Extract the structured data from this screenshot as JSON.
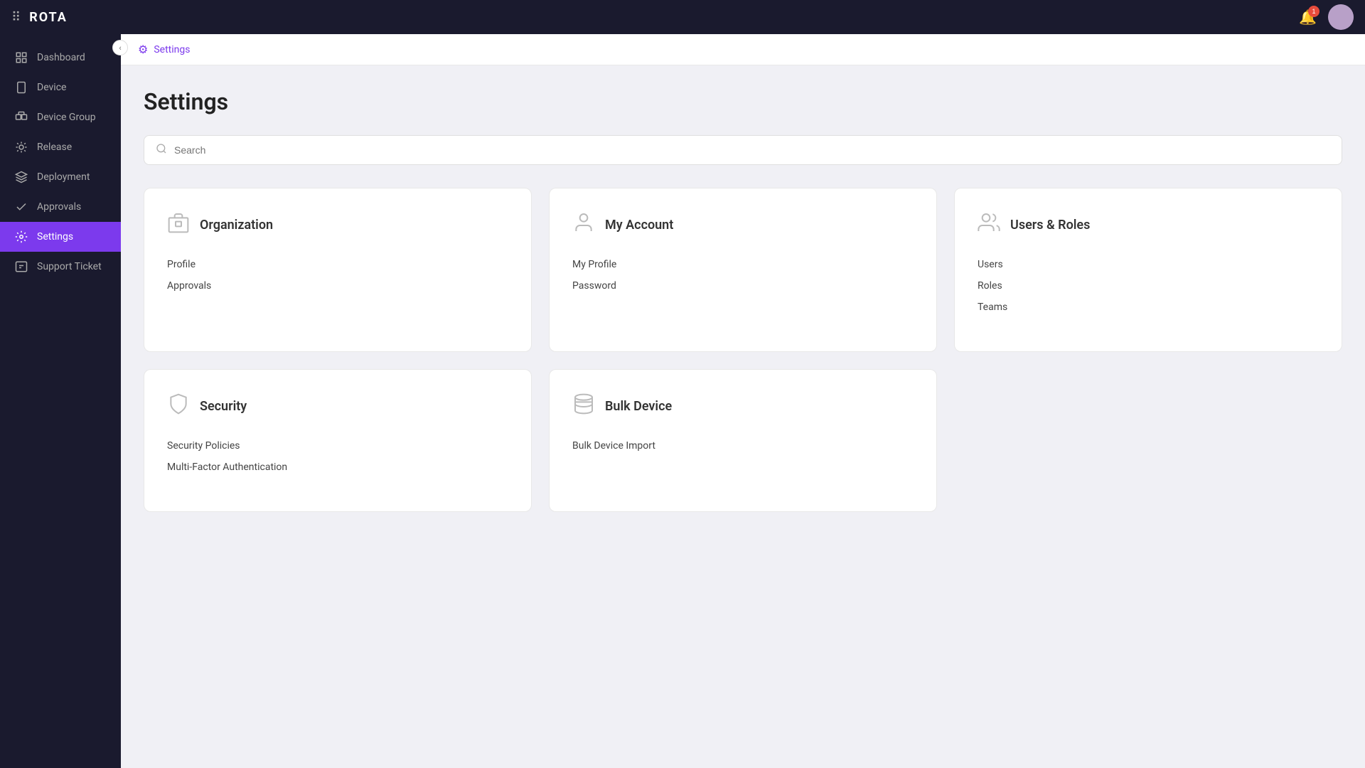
{
  "app": {
    "name": "ROTA"
  },
  "topbar": {
    "notification_count": "1",
    "notification_icon": "🔔"
  },
  "sidebar": {
    "collapse_icon": "‹",
    "items": [
      {
        "id": "dashboard",
        "label": "Dashboard",
        "icon": "dashboard"
      },
      {
        "id": "device",
        "label": "Device",
        "icon": "device"
      },
      {
        "id": "device-group",
        "label": "Device Group",
        "icon": "device-group"
      },
      {
        "id": "release",
        "label": "Release",
        "icon": "release"
      },
      {
        "id": "deployment",
        "label": "Deployment",
        "icon": "deployment"
      },
      {
        "id": "approvals",
        "label": "Approvals",
        "icon": "approvals"
      },
      {
        "id": "settings",
        "label": "Settings",
        "icon": "settings",
        "active": true
      },
      {
        "id": "support-ticket",
        "label": "Support Ticket",
        "icon": "support"
      }
    ]
  },
  "breadcrumb": {
    "text": "Settings"
  },
  "page": {
    "title": "Settings"
  },
  "search": {
    "placeholder": "Search"
  },
  "cards": [
    {
      "id": "organization",
      "title": "Organization",
      "icon": "building",
      "links": [
        "Profile",
        "Approvals"
      ]
    },
    {
      "id": "my-account",
      "title": "My Account",
      "icon": "person",
      "links": [
        "My Profile",
        "Password"
      ]
    },
    {
      "id": "users-roles",
      "title": "Users & Roles",
      "icon": "people",
      "links": [
        "Users",
        "Roles",
        "Teams"
      ]
    }
  ],
  "cards_bottom": [
    {
      "id": "security",
      "title": "Security",
      "icon": "shield",
      "links": [
        "Security Policies",
        "Multi-Factor Authentication"
      ]
    },
    {
      "id": "bulk-device",
      "title": "Bulk Device",
      "icon": "stack",
      "links": [
        "Bulk Device Import"
      ]
    }
  ]
}
